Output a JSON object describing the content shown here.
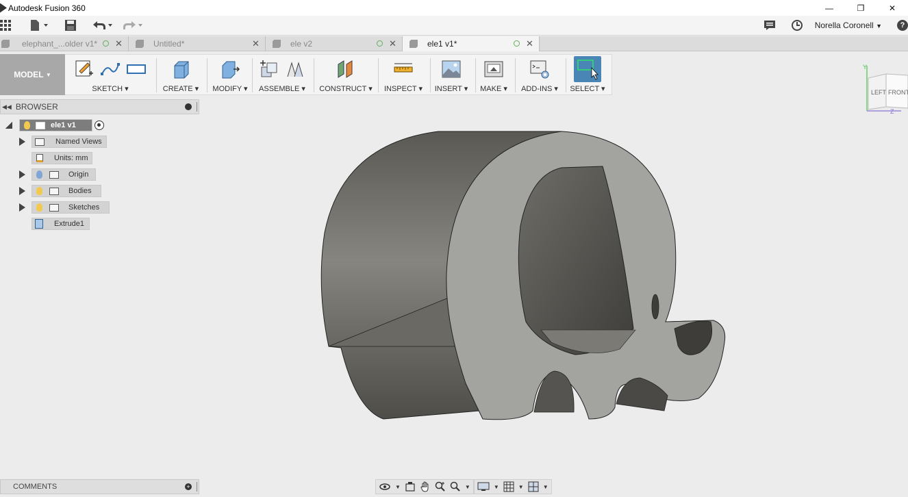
{
  "window": {
    "title": "Autodesk Fusion 360",
    "controls": [
      "—",
      "❐",
      "✕"
    ]
  },
  "quick_access": {
    "user_name": "Norella Coronell",
    "user_caret": "▼",
    "help": "?"
  },
  "tabs": [
    {
      "label": "elephant_...older v1*",
      "active": false
    },
    {
      "label": "Untitled*",
      "active": false
    },
    {
      "label": "ele v2",
      "active": false
    },
    {
      "label": "ele1 v1*",
      "active": true
    }
  ],
  "ribbon": {
    "workspace": "MODEL",
    "groups": [
      {
        "label": "SKETCH"
      },
      {
        "label": "CREATE"
      },
      {
        "label": "MODIFY"
      },
      {
        "label": "ASSEMBLE"
      },
      {
        "label": "CONSTRUCT"
      },
      {
        "label": "INSPECT"
      },
      {
        "label": "INSERT"
      },
      {
        "label": "MAKE"
      },
      {
        "label": "ADD-INS"
      },
      {
        "label": "SELECT"
      }
    ]
  },
  "browser": {
    "title": "BROWSER",
    "root": "ele1 v1",
    "items": [
      {
        "label": "Named Views"
      },
      {
        "label": "Units: mm"
      },
      {
        "label": "Origin"
      },
      {
        "label": "Bodies"
      },
      {
        "label": "Sketches"
      },
      {
        "label": "Extrude1"
      }
    ]
  },
  "comments": {
    "title": "COMMENTS"
  },
  "viewcube": {
    "left": "LEFT",
    "front": "FRONT",
    "axis_y": "Y",
    "axis_z": "Z"
  },
  "colors": {
    "model_face": "#a3a3a0",
    "model_side": "#6f6e69",
    "select_active": "#4a86b5",
    "bulb_on": "#f2c94c",
    "bulb_off": "#7fa6d6"
  }
}
